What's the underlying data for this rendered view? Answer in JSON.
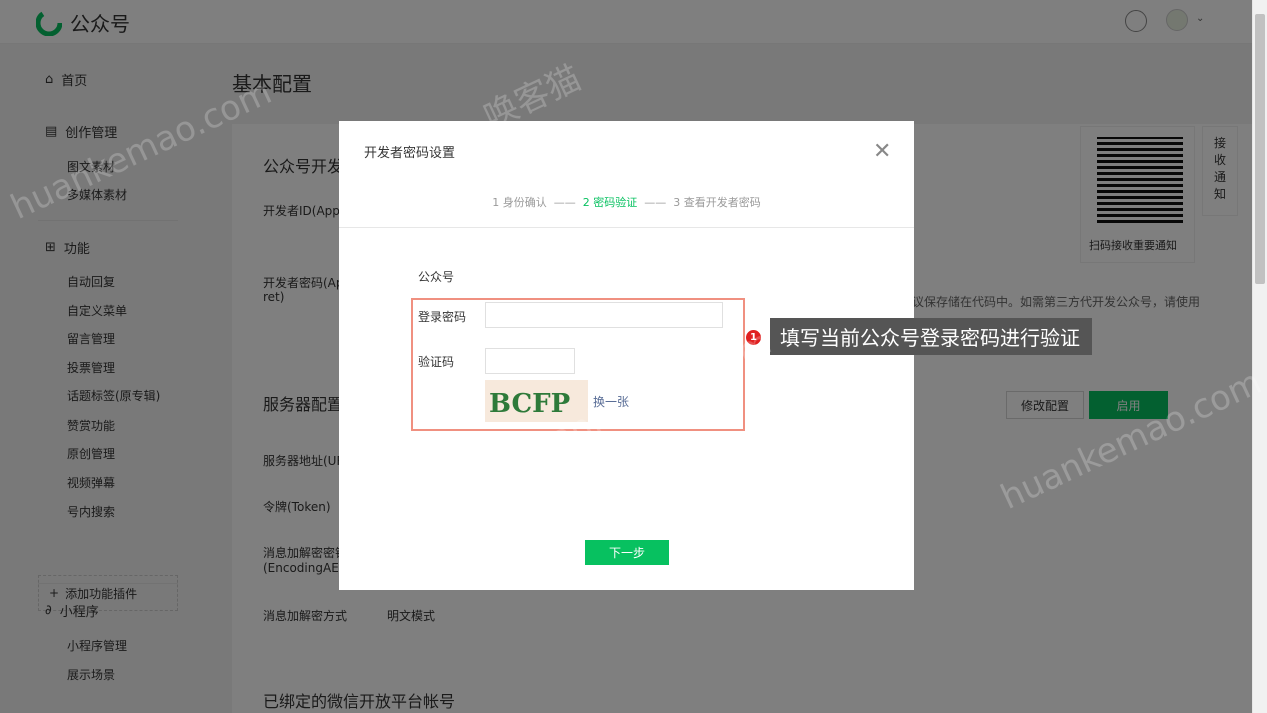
{
  "topbar": {
    "logo_text": "公众号"
  },
  "sidebar": {
    "home": "首页",
    "creation": "创作管理",
    "creation_items": [
      "图文素材",
      "多媒体素材"
    ],
    "features": "功能",
    "feature_items": [
      "自动回复",
      "自定义菜单",
      "留言管理",
      "投票管理",
      "话题标签(原专辑)",
      "赞赏功能",
      "原创管理",
      "视频弹幕",
      "号内搜索"
    ],
    "add_plugin": "添加功能插件",
    "miniprogram": "小程序",
    "miniprogram_items": [
      "小程序管理",
      "展示场景"
    ]
  },
  "main": {
    "page_title": "基本配置",
    "section1": "公众号开发",
    "dev_id_label": "开发者ID(AppI",
    "dev_secret_label_1": "开发者密码(Ap",
    "dev_secret_label_2": "ret)",
    "notice_text": "建议保存储在代码中。如需第三方代开发公众号，请使用",
    "section2": "服务器配置",
    "modify_btn": "修改配置",
    "enable_btn": "启用",
    "server_url_label": "服务器地址(UR",
    "token_label": "令牌(Token)",
    "aes_label_1": "消息加解密密钥",
    "aes_label_2": "(EncodingAESI",
    "encrypt_mode_label": "消息加解密方式",
    "encrypt_mode_value": "明文模式",
    "section3": "已绑定的微信开放平台帐号"
  },
  "qr": {
    "caption": "扫码接收重要通知"
  },
  "side_tab": {
    "label": [
      "接",
      "收",
      "通",
      "知"
    ]
  },
  "modal": {
    "title": "开发者密码设置",
    "steps": [
      "1 身份确认",
      "2 密码验证",
      "3 查看开发者密码"
    ],
    "step_sep": "——",
    "account_label": "公众号",
    "password_label": "登录密码",
    "captcha_label": "验证码",
    "captcha_text": "BCFP",
    "refresh_link": "换一张",
    "next_btn": "下一步"
  },
  "callout": {
    "number": "1",
    "text": "填写当前公众号登录密码进行验证"
  },
  "watermark": {
    "cn": "唤客猫",
    "en": "huankemao.com"
  },
  "colors": {
    "accent": "#07c160",
    "link": "#576b95",
    "highlight": "#f09080",
    "callout_dot": "#e02020"
  }
}
